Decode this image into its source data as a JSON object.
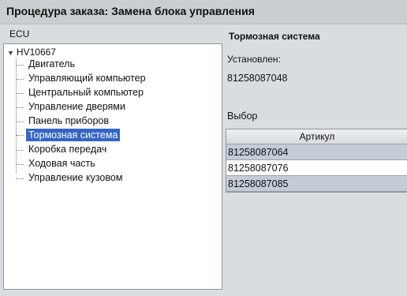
{
  "window": {
    "title": "Процедура заказа: Замена блока управления"
  },
  "left_panel": {
    "header": "ECU",
    "tree": {
      "root": "HV10667",
      "items": [
        {
          "label": "Двигатель",
          "selected": false
        },
        {
          "label": "Управляющий компьютер",
          "selected": false
        },
        {
          "label": "Центральный компьютер",
          "selected": false
        },
        {
          "label": "Управление дверями",
          "selected": false
        },
        {
          "label": "Панель приборов",
          "selected": false
        },
        {
          "label": "Тормозная система",
          "selected": true
        },
        {
          "label": "Коробка передач",
          "selected": false
        },
        {
          "label": "Ходовая часть",
          "selected": false
        },
        {
          "label": "Управление кузовом",
          "selected": false
        }
      ]
    }
  },
  "right_panel": {
    "header": "Тормозная система",
    "installed_label": "Установлен:",
    "installed_value": "81258087048",
    "choice_label": "Выбор",
    "table": {
      "column_header": "Артикул",
      "rows": [
        "81258087064",
        "81258087076",
        "81258087085"
      ]
    }
  },
  "colors": {
    "selection": "#3465c7",
    "row_shade": "#c4ccd8",
    "background": "#d8dde0"
  }
}
